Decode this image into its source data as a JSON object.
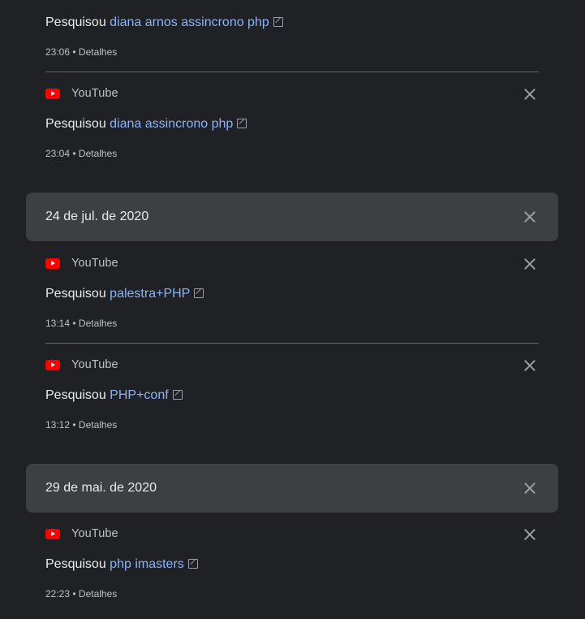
{
  "icons": {
    "source": "youtube-icon",
    "close": "close-icon",
    "external": "external-link-icon"
  },
  "colors": {
    "background": "#202124",
    "header_bg": "#3c4043",
    "link": "#8ab4f8",
    "text": "#e8eaed",
    "secondary": "#bdc1c6",
    "youtube_red": "#ff0000"
  },
  "entries": [
    {
      "verb": "Pesquisou",
      "query": "diana arnos assincrono php",
      "time": "23:06",
      "details": "Detalhes"
    },
    {
      "source": "YouTube",
      "verb": "Pesquisou",
      "query": "diana assincrono php",
      "time": "23:04",
      "details": "Detalhes"
    },
    {
      "source": "YouTube",
      "verb": "Pesquisou",
      "query": "palestra+PHP",
      "time": "13:14",
      "details": "Detalhes"
    },
    {
      "source": "YouTube",
      "verb": "Pesquisou",
      "query": "PHP+conf",
      "time": "13:12",
      "details": "Detalhes"
    },
    {
      "source": "YouTube",
      "verb": "Pesquisou",
      "query": "php imasters",
      "time": "22:23",
      "details": "Detalhes"
    }
  ],
  "date_headers": [
    {
      "label": "24 de jul. de 2020"
    },
    {
      "label": "29 de mai. de 2020"
    }
  ],
  "separator": "•"
}
